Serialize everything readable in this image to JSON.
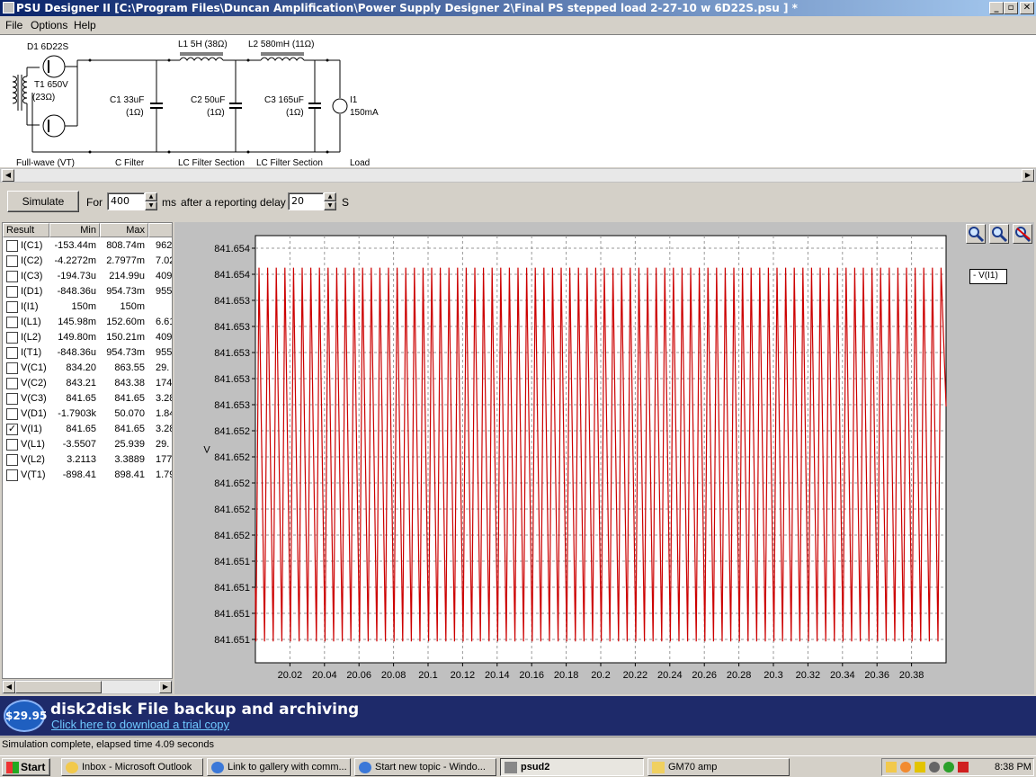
{
  "window": {
    "title": "PSU Designer II  [C:\\Program Files\\Duncan Amplification\\Power Supply Designer 2\\Final PS stepped load 2-27-10 w 6D22S.psu ] *",
    "min_label": "_",
    "max_label": "▫",
    "close_label": "✕"
  },
  "menu": {
    "items": [
      "File",
      "Options",
      "Help"
    ]
  },
  "schematic": {
    "d1": "D1 6D22S",
    "t1_a": "T1 650V",
    "t1_b": "(23Ω)",
    "l1": "L1 5H (38Ω)",
    "l2": "L2 580mH (11Ω)",
    "c1_a": "C1 33uF",
    "c1_b": "(1Ω)",
    "c2_a": "C2 50uF",
    "c2_b": "(1Ω)",
    "c3_a": "C3 165uF",
    "c3_b": "(1Ω)",
    "i1_a": "I1",
    "i1_b": "150mA",
    "sections": [
      "Full-wave (VT)",
      "C Filter",
      "LC Filter Section",
      "LC Filter Section",
      "Load"
    ]
  },
  "controls": {
    "simulate": "Simulate",
    "for_label": "For",
    "duration": "400",
    "ms_label": "ms",
    "delay_label": "after a reporting delay of",
    "delay": "20",
    "s_label": "S"
  },
  "results": {
    "headers": [
      "Result",
      "Min",
      "Max"
    ],
    "rows": [
      {
        "name": "I(C1)",
        "min": "-153.44m",
        "max": "808.74m",
        "extra": "962.",
        "checked": false
      },
      {
        "name": "I(C2)",
        "min": "-4.2272m",
        "max": "2.7977m",
        "extra": "7.02",
        "checked": false
      },
      {
        "name": "I(C3)",
        "min": "-194.73u",
        "max": "214.99u",
        "extra": "409.",
        "checked": false
      },
      {
        "name": "I(D1)",
        "min": "-848.36u",
        "max": "954.73m",
        "extra": "955.",
        "checked": false
      },
      {
        "name": "I(I1)",
        "min": "150m",
        "max": "150m",
        "extra": "",
        "checked": false
      },
      {
        "name": "I(L1)",
        "min": "145.98m",
        "max": "152.60m",
        "extra": "6.61",
        "checked": false
      },
      {
        "name": "I(L2)",
        "min": "149.80m",
        "max": "150.21m",
        "extra": "409.",
        "checked": false
      },
      {
        "name": "I(T1)",
        "min": "-848.36u",
        "max": "954.73m",
        "extra": "955.",
        "checked": false
      },
      {
        "name": "V(C1)",
        "min": "834.20",
        "max": "863.55",
        "extra": "29.",
        "checked": false
      },
      {
        "name": "V(C2)",
        "min": "843.21",
        "max": "843.38",
        "extra": "174.",
        "checked": false
      },
      {
        "name": "V(C3)",
        "min": "841.65",
        "max": "841.65",
        "extra": "3.28",
        "checked": false
      },
      {
        "name": "V(D1)",
        "min": "-1.7903k",
        "max": "50.070",
        "extra": "1.84",
        "checked": false
      },
      {
        "name": "V(I1)",
        "min": "841.65",
        "max": "841.65",
        "extra": "3.28",
        "checked": true
      },
      {
        "name": "V(L1)",
        "min": "-3.5507",
        "max": "25.939",
        "extra": "29.",
        "checked": false
      },
      {
        "name": "V(L2)",
        "min": "3.2113",
        "max": "3.3889",
        "extra": "177.",
        "checked": false
      },
      {
        "name": "V(T1)",
        "min": "-898.41",
        "max": "898.41",
        "extra": "1.79",
        "checked": false
      }
    ]
  },
  "plot": {
    "legend": "- V(I1)",
    "ylabel": "V",
    "line_color": "#cc0000",
    "zoom_icons": [
      "zoom-in-icon",
      "zoom-out-icon",
      "zoom-reset-icon"
    ]
  },
  "chart_data": {
    "type": "line",
    "title": "",
    "xlabel": "",
    "ylabel": "V",
    "x_ticks": [
      "20.02",
      "20.04",
      "20.06",
      "20.08",
      "20.1",
      "20.12",
      "20.14",
      "20.16",
      "20.18",
      "20.2",
      "20.22",
      "20.24",
      "20.26",
      "20.28",
      "20.3",
      "20.32",
      "20.34",
      "20.36",
      "20.38"
    ],
    "y_ticks": [
      "841.654",
      "841.654",
      "841.653",
      "841.653",
      "841.653",
      "841.653",
      "841.653",
      "841.652",
      "841.652",
      "841.652",
      "841.652",
      "841.652",
      "841.651",
      "841.651",
      "841.651",
      "841.651"
    ],
    "xlim": [
      20.0,
      20.4
    ],
    "ylim": [
      841.6505,
      841.6545
    ],
    "series": [
      {
        "name": "V(I1)",
        "period_s": 0.01,
        "min": 841.6507,
        "max": 841.6542
      }
    ],
    "grid": true,
    "legend_position": "right"
  },
  "banner": {
    "price": "$29.95",
    "headline": "disk2disk File backup and archiving",
    "link": "Click here to download a trial copy"
  },
  "status": {
    "text": "Simulation complete, elapsed time 4.09 seconds"
  },
  "taskbar": {
    "start": "Start",
    "tasks": [
      "Inbox - Microsoft Outlook",
      "Link to gallery with comm...",
      "Start new topic - Windo...",
      "psud2",
      "GM70 amp"
    ],
    "clock": "8:38 PM"
  }
}
